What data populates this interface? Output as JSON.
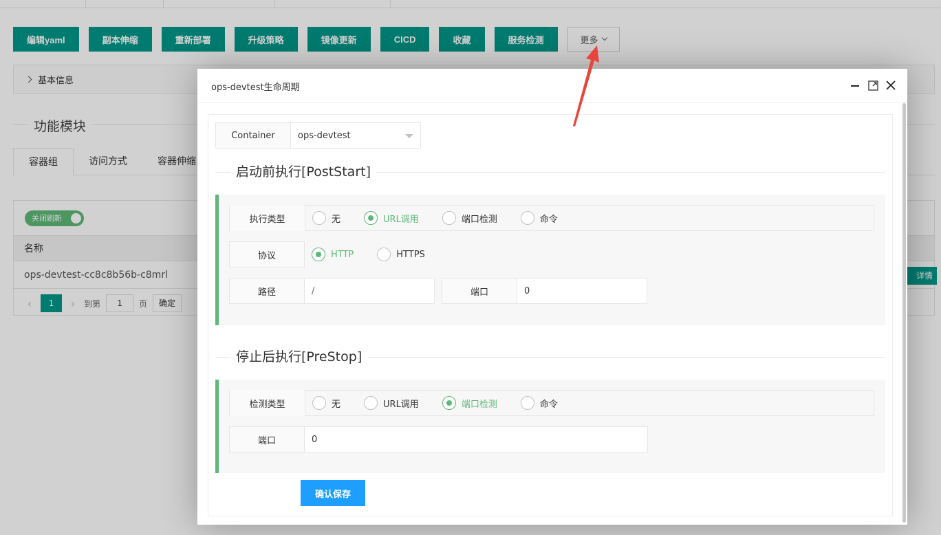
{
  "toolbar": {
    "buttons": [
      "编辑yaml",
      "副本伸缩",
      "重新部署",
      "升级策略",
      "镜像更新",
      "CICD",
      "收藏",
      "服务检测"
    ],
    "more_label": "更多"
  },
  "basic_info_label": "基本信息",
  "module_title": "功能模块",
  "tabs": [
    "容器组",
    "访问方式",
    "容器伸缩"
  ],
  "table": {
    "switch_label": "关闭刷新",
    "header_name": "名称",
    "row_name": "ops-devtest-cc8c8b56b-c8mrl",
    "detail_label": "详情"
  },
  "pager": {
    "current": "1",
    "goto_label": "到第",
    "goto_value": "1",
    "page_label": "页",
    "confirm_label": "确定"
  },
  "modal": {
    "title": "ops-devtest生命周期",
    "container_label": "Container",
    "container_value": "ops-devtest",
    "poststart": {
      "title": "启动前执行[PostStart]",
      "type_label": "执行类型",
      "type_options": [
        "无",
        "URL调用",
        "端口检测",
        "命令"
      ],
      "type_selected": 1,
      "protocol_label": "协议",
      "protocol_options": [
        "HTTP",
        "HTTPS"
      ],
      "protocol_selected": 0,
      "path_label": "路径",
      "path_value": "/",
      "port_label": "端口",
      "port_value": "0"
    },
    "prestop": {
      "title": "停止后执行[PreStop]",
      "type_label": "检测类型",
      "type_options": [
        "无",
        "URL调用",
        "端口检测",
        "命令"
      ],
      "type_selected": 2,
      "port_label": "端口",
      "port_value": "0"
    },
    "save_label": "确认保存"
  },
  "colors": {
    "primary": "#009688",
    "accent_green": "#5fb878",
    "save_blue": "#1e9fff",
    "annotation_red": "#e8453c"
  }
}
